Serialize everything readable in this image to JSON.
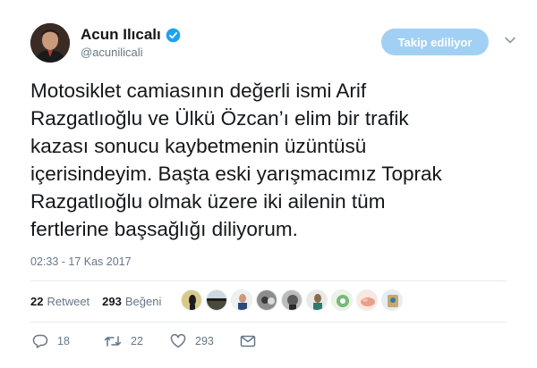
{
  "user": {
    "display_name": "Acun Ilıcalı",
    "handle": "@acunilicali"
  },
  "follow_button_label": "Takip ediliyor",
  "tweet_lines": [
    "Motosiklet camiasının değerli ismi Arif",
    "Razgatlıoğlu ve Ülkü Özcan’ı elim bir trafik",
    "kazası sonucu kaybetmenin üzüntüsü",
    "içerisindeyim. Başta eski yarışmacımız Toprak",
    "Razgatlıoğlu olmak üzere iki ailenin tüm",
    "fertlerine başsağlığı diliyorum."
  ],
  "timestamp": "02:33 - 17 Kas 2017",
  "stats": {
    "retweet_count": "22",
    "retweet_label": "Retweet",
    "like_count": "293",
    "like_label": "Beğeni"
  },
  "actions": {
    "reply_count": "18",
    "retweet_count": "22",
    "like_count": "293"
  },
  "colors": {
    "follow_button_bg": "#a2d0f4",
    "verified": "#1da1f2",
    "secondary_text": "#657786"
  }
}
